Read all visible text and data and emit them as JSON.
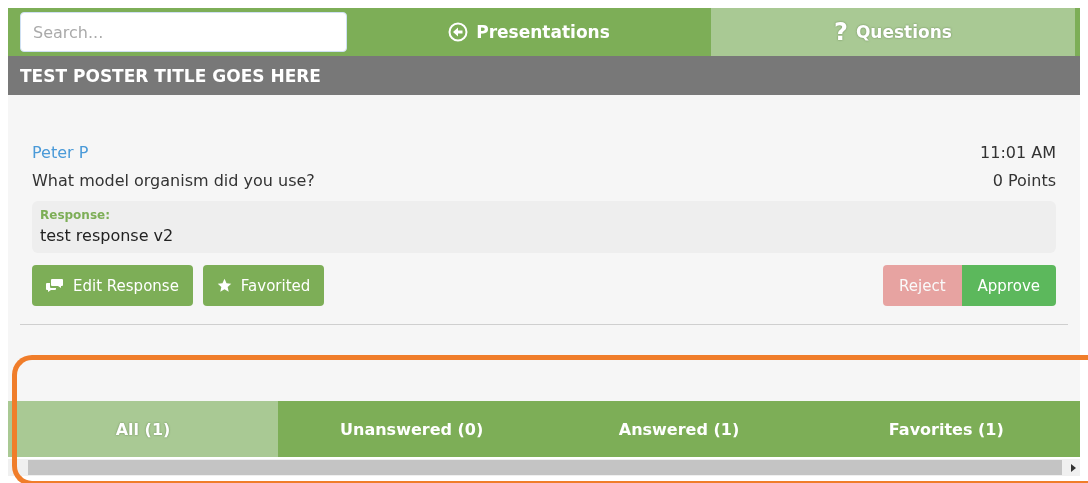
{
  "search": {
    "placeholder": "Search..."
  },
  "tabs": [
    {
      "label": "Presentations",
      "kind": "back",
      "selected": false
    },
    {
      "label": "Questions",
      "kind": "question",
      "icon_char": "?",
      "selected": true
    }
  ],
  "poster_title": "TEST POSTER TITLE GOES HERE",
  "question": {
    "author": "Peter P",
    "text": "What model organism did you use?",
    "time": "11:01 AM",
    "points": "0 Points",
    "response_label": "Response:",
    "response": "test response v2",
    "actions": [
      {
        "label": "Edit Response",
        "kind": "edit"
      },
      {
        "label": "Favorited",
        "kind": "favorite"
      }
    ],
    "moderation": [
      {
        "label": "Reject",
        "kind": "reject",
        "disabled": true
      },
      {
        "label": "Approve",
        "kind": "approve",
        "disabled": false
      }
    ]
  },
  "filter_tabs": [
    {
      "label": "All (1)",
      "selected": true
    },
    {
      "label": "Unanswered (0)",
      "selected": false
    },
    {
      "label": "Answered (1)",
      "selected": false
    },
    {
      "label": "Favorites (1)",
      "selected": false
    }
  ]
}
